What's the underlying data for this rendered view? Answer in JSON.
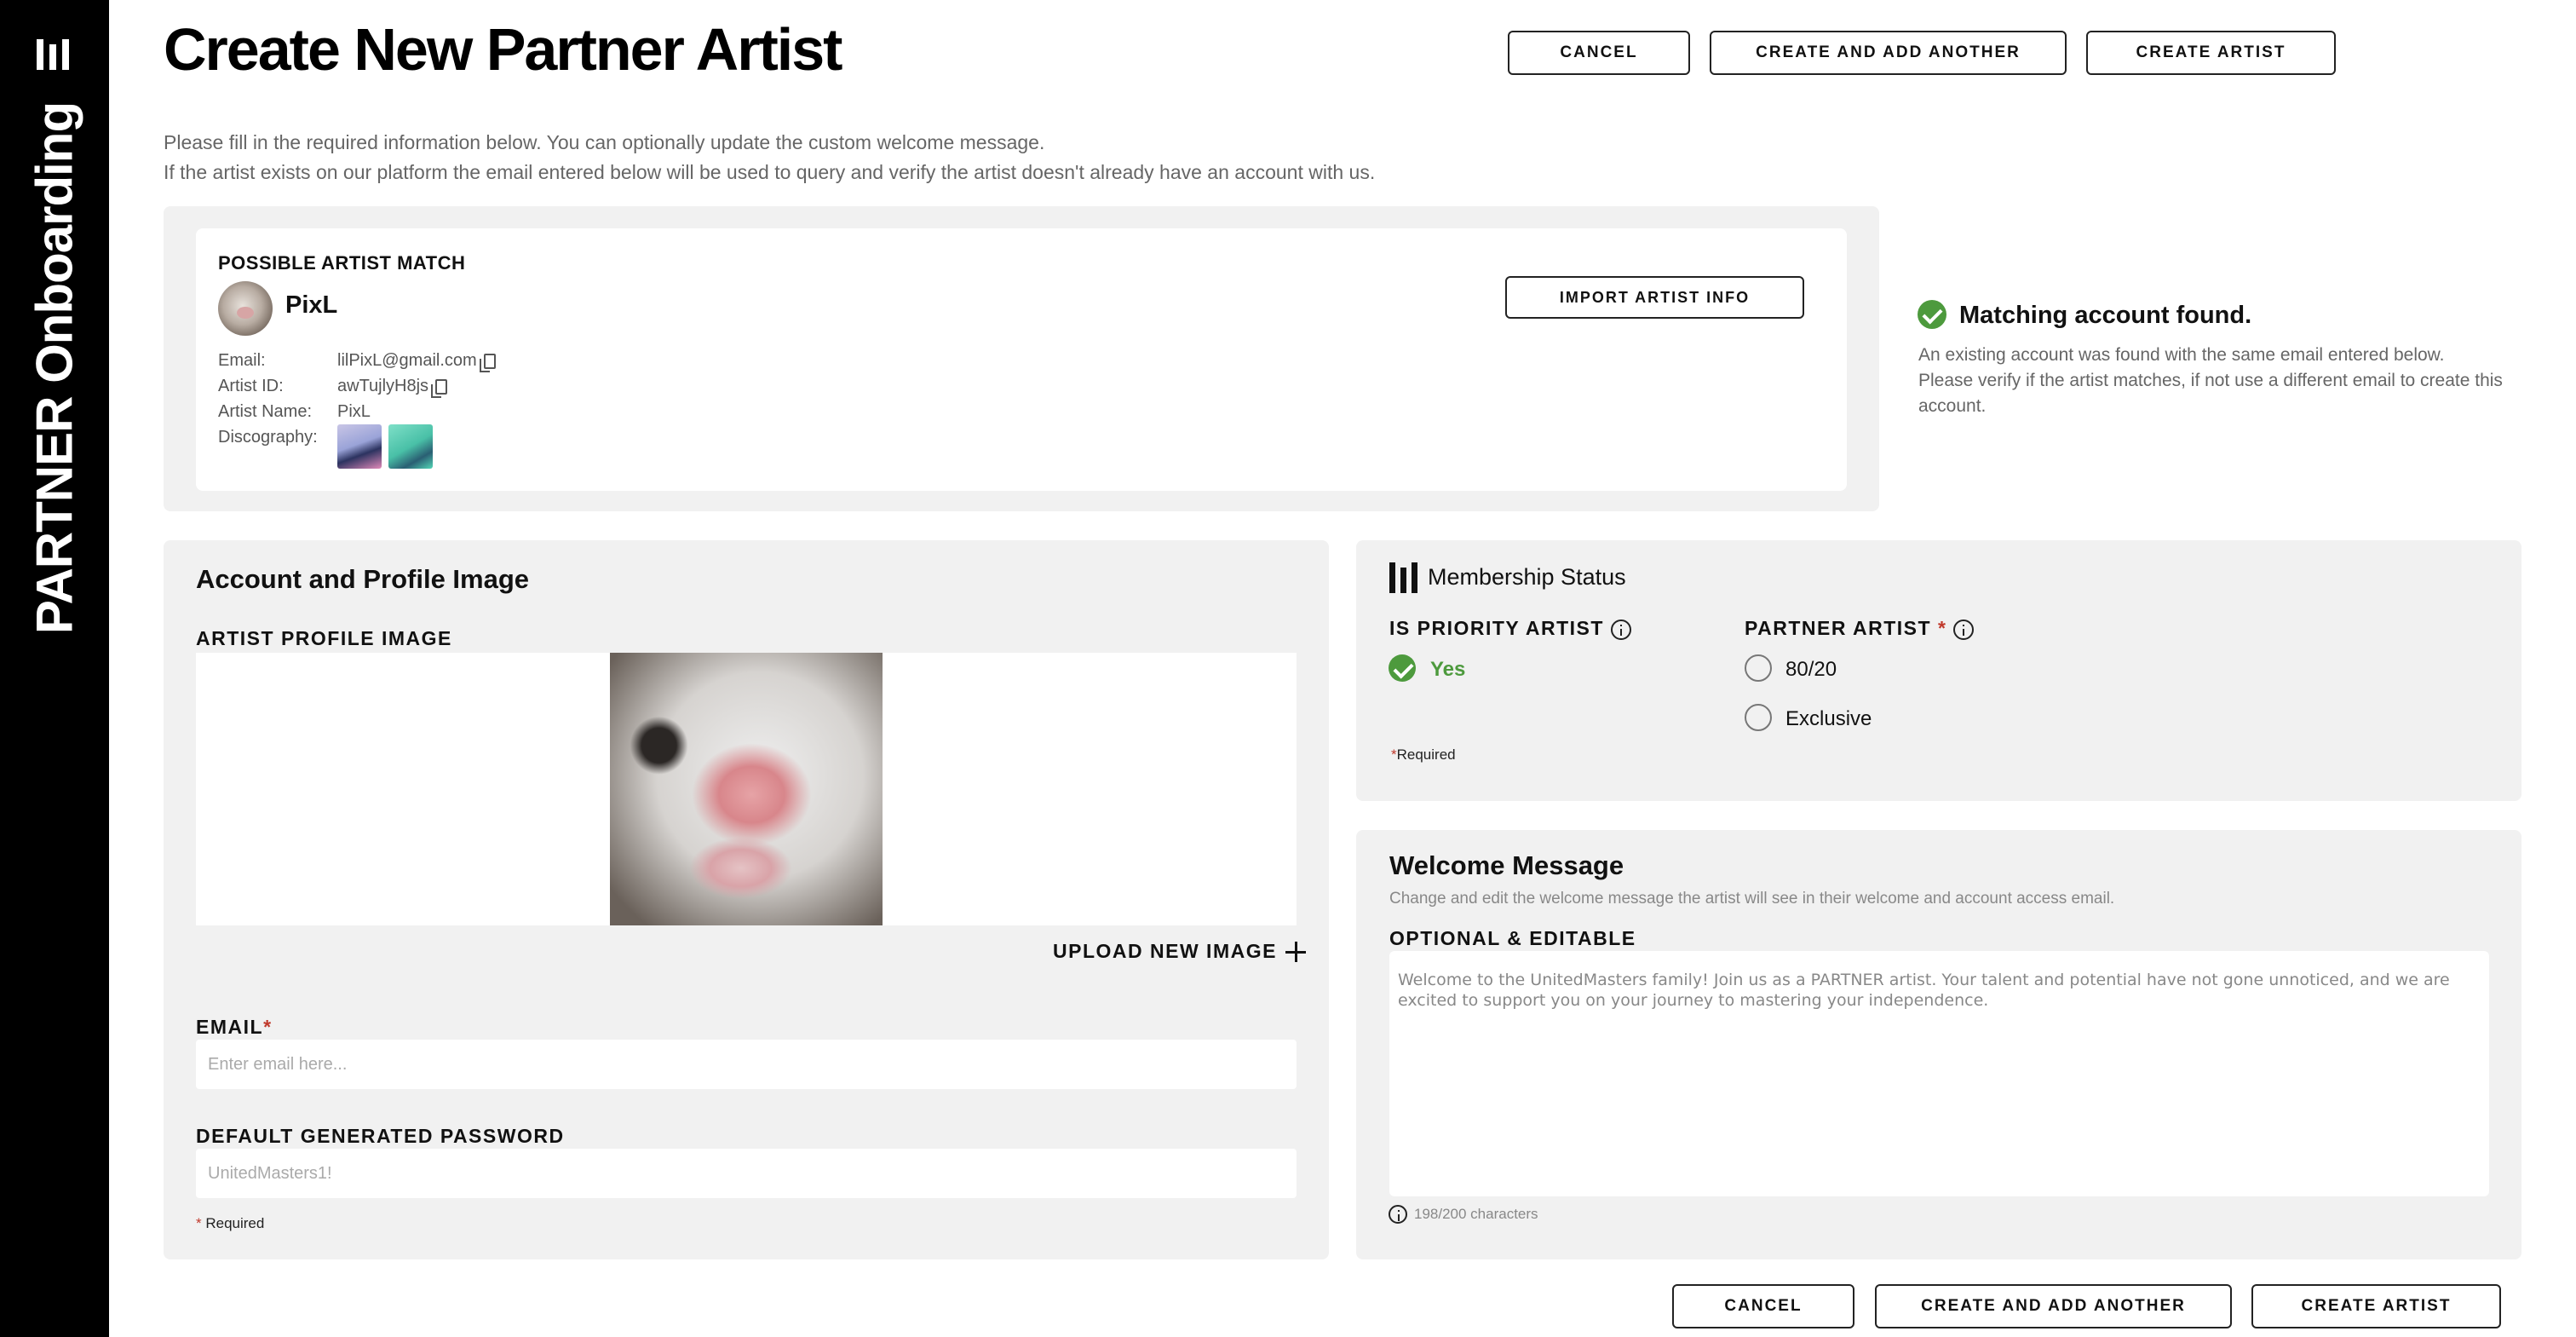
{
  "sidebar": {
    "brand_title": "PARTNER Onboarding"
  },
  "header": {
    "title": "Create New Partner Artist",
    "cancel_label": "CANCEL",
    "create_add_another_label": "CREATE AND ADD ANOTHER",
    "create_artist_label": "CREATE ARTIST",
    "intro_line1": "Please fill in the required information below. You can optionally update the custom welcome message.",
    "intro_line2": "If the artist exists on our platform the email entered below will be used to query and verify the artist doesn't already have an account with us."
  },
  "artist_match": {
    "heading": "POSSIBLE ARTIST MATCH",
    "name": "PixL",
    "import_label": "IMPORT ARTIST INFO",
    "email_label": "Email:",
    "email_value": "lilPixL@gmail.com",
    "artist_id_label": "Artist ID:",
    "artist_id_value": "awTujlyH8js",
    "artist_name_label": "Artist Name:",
    "artist_name_value": "PixL",
    "discography_label": "Discography:"
  },
  "match_status": {
    "title": "Matching account found.",
    "line1": "An existing account was found with the same email entered below.",
    "line2": "Please verify if the artist matches, if not use a different email to create this",
    "line3": "account."
  },
  "account": {
    "title": "Account and Profile Image",
    "profile_image_label": "ARTIST PROFILE IMAGE",
    "upload_label": "UPLOAD NEW IMAGE",
    "email_label": "EMAIL",
    "email_placeholder": "Enter email here...",
    "password_label": "DEFAULT GENERATED PASSWORD",
    "password_placeholder": "UnitedMasters1!",
    "required_note": "Required"
  },
  "membership": {
    "title": "Membership Status",
    "priority_label": "IS PRIORITY ARTIST",
    "priority_value": "Yes",
    "partner_label": "PARTNER ARTIST",
    "option_1": "80/20",
    "option_2": "Exclusive",
    "required_note": "Required"
  },
  "welcome": {
    "title": "Welcome Message",
    "subtitle": "Change and edit the welcome message the artist will see in their welcome and account access email.",
    "optional_label": "OPTIONAL & EDITABLE",
    "message": "Welcome to the UnitedMasters family! Join us as a PARTNER artist. Your talent and potential have not gone unnoticed, and we are excited to support you on your journey to mastering your independence.",
    "char_count": "198/200 characters"
  },
  "footer": {
    "cancel_label": "CANCEL",
    "create_add_another_label": "CREATE AND ADD ANOTHER",
    "create_artist_label": "CREATE ARTIST"
  },
  "colors": {
    "accent_green": "#4d9a3d",
    "required_red": "#c0392b",
    "sidebar": "#000000"
  }
}
